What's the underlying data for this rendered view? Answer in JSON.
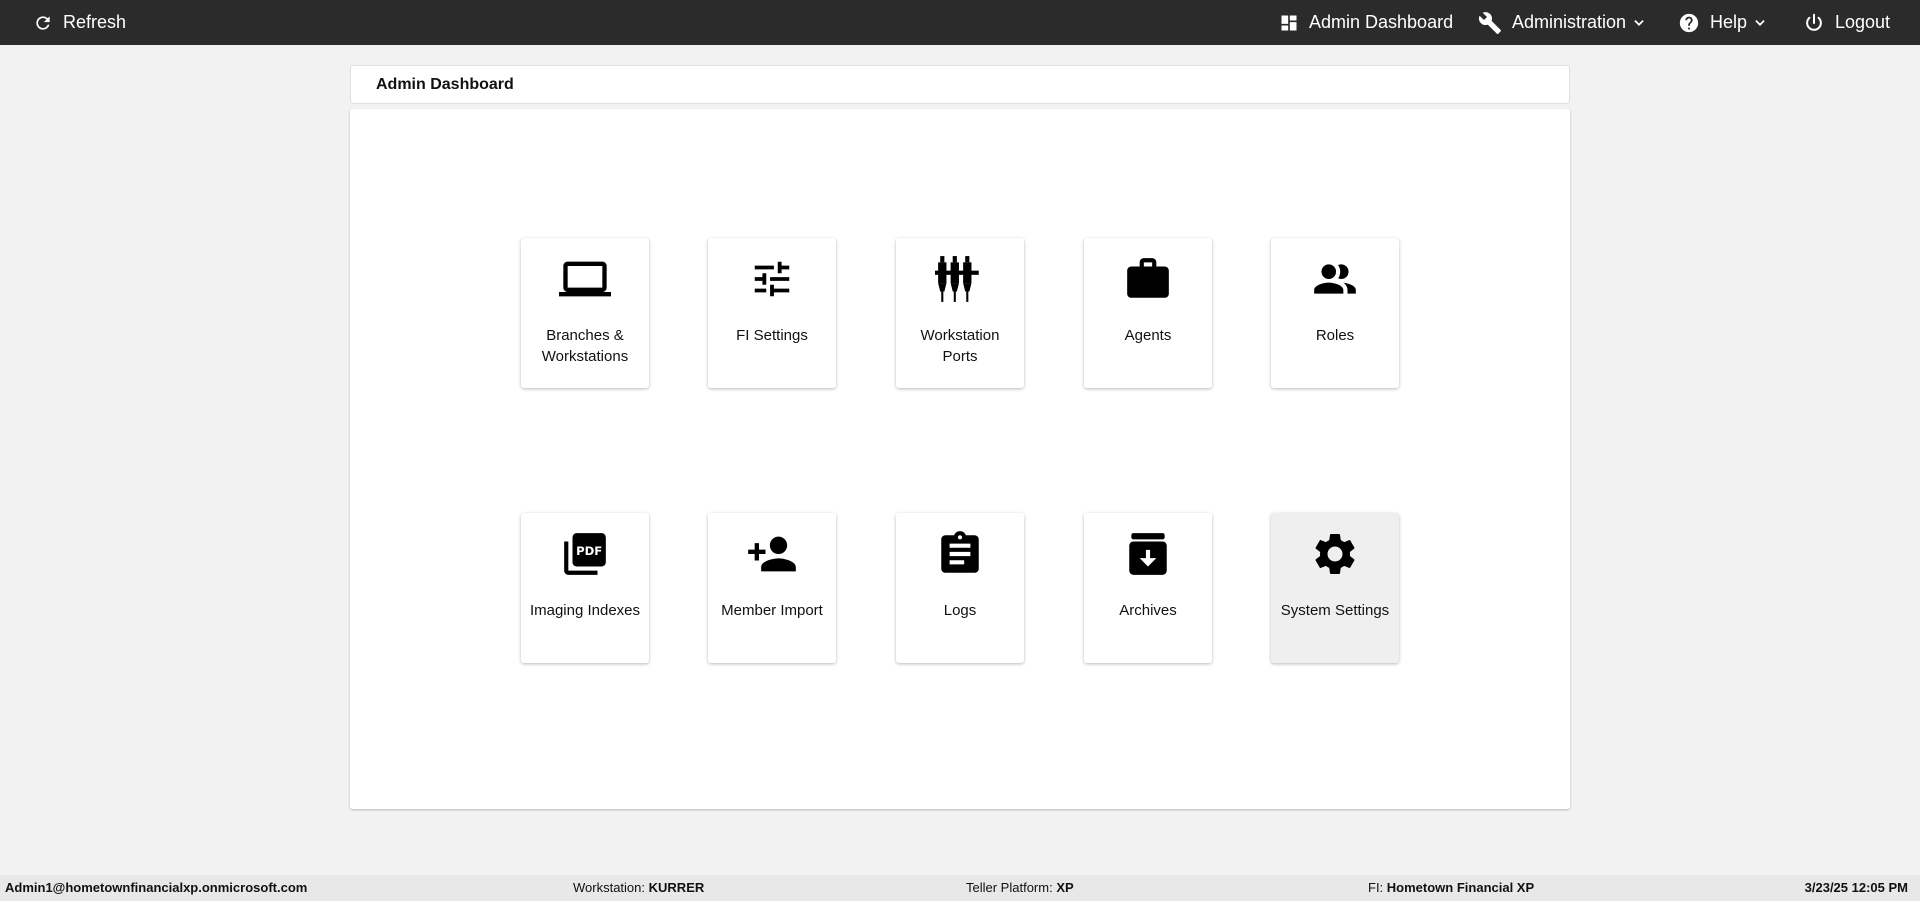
{
  "topbar": {
    "refresh_label": "Refresh",
    "dashboard_label": "Admin Dashboard",
    "administration_label": "Administration",
    "help_label": "Help",
    "logout_label": "Logout"
  },
  "page_title": "Admin Dashboard",
  "tiles": [
    {
      "label": "Branches & Workstations",
      "icon": "laptop-icon"
    },
    {
      "label": "FI Settings",
      "icon": "tune-sliders-icon"
    },
    {
      "label": "Workstation Ports",
      "icon": "ports-icon"
    },
    {
      "label": "Agents",
      "icon": "briefcase-icon"
    },
    {
      "label": "Roles",
      "icon": "people-icon"
    },
    {
      "label": "Imaging Indexes",
      "icon": "pdf-icon"
    },
    {
      "label": "Member Import",
      "icon": "person-add-icon"
    },
    {
      "label": "Logs",
      "icon": "clipboard-icon"
    },
    {
      "label": "Archives",
      "icon": "archive-icon"
    },
    {
      "label": "System Settings",
      "icon": "gear-icon"
    }
  ],
  "footer": {
    "user": "Admin1@hometownfinancialxp.onmicrosoft.com",
    "workstation_label": "Workstation:",
    "workstation_value": "KURRER",
    "platform_label": "Teller Platform:",
    "platform_value": "XP",
    "fi_label": "FI:",
    "fi_value": "Hometown Financial XP",
    "datetime": "3/23/25 12:05 PM"
  },
  "colors": {
    "topbar": "#2b2b2b",
    "page_bg": "#f2f2f2",
    "tile_hover": "#efefef"
  }
}
